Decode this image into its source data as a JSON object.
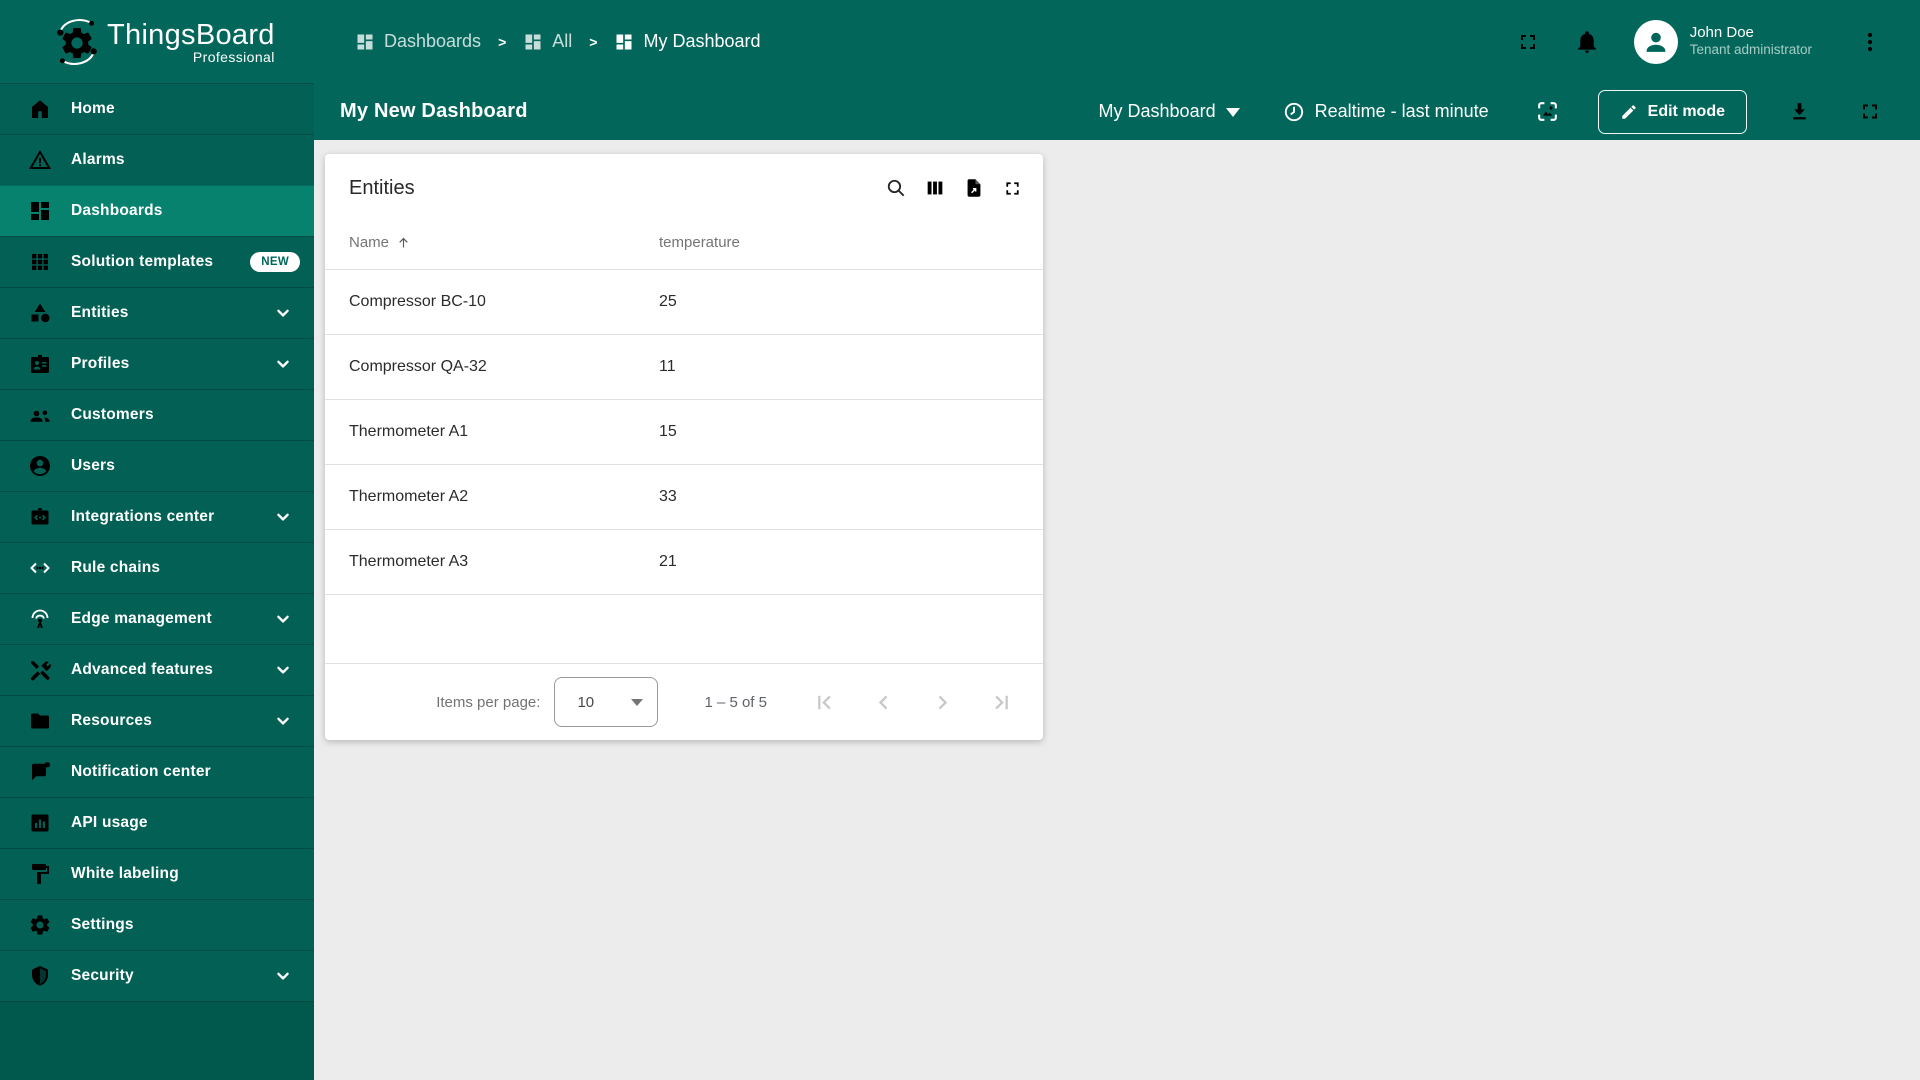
{
  "brand": {
    "name": "ThingsBoard",
    "edition": "Professional"
  },
  "sidebar": {
    "items": [
      {
        "label": "Home",
        "active": false
      },
      {
        "label": "Alarms",
        "active": false
      },
      {
        "label": "Dashboards",
        "active": true
      },
      {
        "label": "Solution templates",
        "active": false,
        "badge": "NEW"
      },
      {
        "label": "Entities",
        "active": false,
        "expandable": true
      },
      {
        "label": "Profiles",
        "active": false,
        "expandable": true
      },
      {
        "label": "Customers",
        "active": false
      },
      {
        "label": "Users",
        "active": false
      },
      {
        "label": "Integrations center",
        "active": false,
        "expandable": true
      },
      {
        "label": "Rule chains",
        "active": false
      },
      {
        "label": "Edge management",
        "active": false,
        "expandable": true
      },
      {
        "label": "Advanced features",
        "active": false,
        "expandable": true
      },
      {
        "label": "Resources",
        "active": false,
        "expandable": true
      },
      {
        "label": "Notification center",
        "active": false
      },
      {
        "label": "API usage",
        "active": false
      },
      {
        "label": "White labeling",
        "active": false
      },
      {
        "label": "Settings",
        "active": false
      },
      {
        "label": "Security",
        "active": false,
        "expandable": true
      }
    ]
  },
  "breadcrumb": {
    "items": [
      "Dashboards",
      "All",
      "My Dashboard"
    ]
  },
  "header": {
    "user": {
      "name": "John Doe",
      "role": "Tenant administrator"
    }
  },
  "toolbar": {
    "title": "My New Dashboard",
    "state_selector": "My Dashboard",
    "timewindow": "Realtime - last minute",
    "edit_button": "Edit mode"
  },
  "widget": {
    "title": "Entities",
    "table": {
      "columns": [
        "Name",
        "temperature"
      ],
      "sort": {
        "column": "Name",
        "direction": "asc"
      },
      "rows": [
        [
          "Compressor BC-10",
          "25"
        ],
        [
          "Compressor QA-32",
          "11"
        ],
        [
          "Thermometer A1",
          "15"
        ],
        [
          "Thermometer A2",
          "33"
        ],
        [
          "Thermometer A3",
          "21"
        ]
      ]
    },
    "pagination": {
      "items_per_page_label": "Items per page:",
      "page_size": "10",
      "range": "1 – 5 of 5"
    }
  },
  "colors": {
    "primary": "#02675a",
    "sidebar_active": "#07826f",
    "content_background": "#ececec",
    "card_background": "#ffffff"
  }
}
